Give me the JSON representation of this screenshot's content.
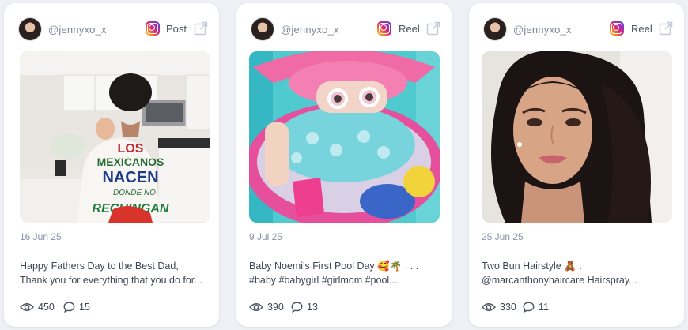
{
  "posts": [
    {
      "handle": "@jennyxo_x",
      "type": "Post",
      "date": "16 Jun 25",
      "caption_line1": "Happy Fathers Day to the Best Dad,",
      "caption_line2": "Thank you for everything that you do for...",
      "views": "450",
      "comments": "15",
      "shirt_text": [
        "LOS",
        "MEXICANOS",
        "NACEN",
        "DONDE NO",
        "RECHINGAN"
      ]
    },
    {
      "handle": "@jennyxo_x",
      "type": "Reel",
      "date": "9 Jul 25",
      "caption_line1": "Baby Noemi's First Pool Day 🥰🌴 . . .",
      "caption_line2": "#baby #babygirl #girlmom #pool...",
      "views": "390",
      "comments": "13"
    },
    {
      "handle": "@jennyxo_x",
      "type": "Reel",
      "date": "25 Jun 25",
      "caption_line1": "Two Bun Hairstyle 🧸 .",
      "caption_line2": "@marcanthonyhaircare Hairspray...",
      "views": "330",
      "comments": "11"
    }
  ],
  "icons": {
    "platform": "instagram-icon",
    "open": "external-link-icon",
    "views": "eye-icon",
    "comments": "comment-icon"
  },
  "colors": {
    "background": "#eef0f5",
    "card": "#ffffff",
    "muted_text": "#8a93a6",
    "body_text": "#3e4655"
  }
}
